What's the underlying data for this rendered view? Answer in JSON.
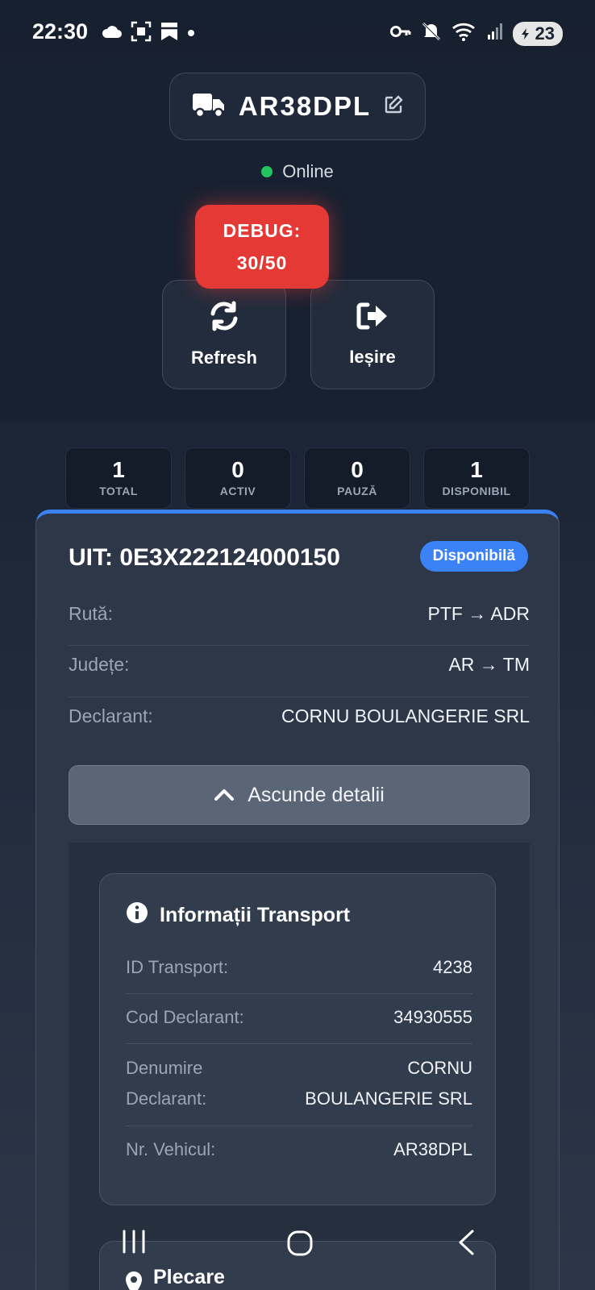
{
  "status_bar": {
    "time": "22:30",
    "battery": "23",
    "icons_left": [
      "cloud-icon",
      "screenshot-icon",
      "bookmark-icon",
      "dot-icon"
    ],
    "icons_right": [
      "key-icon",
      "mute-icon",
      "wifi-icon",
      "signal-icon"
    ]
  },
  "header": {
    "vehicle_plate": "AR38DPL",
    "connection_status": "Online",
    "debug_label": "DEBUG:",
    "debug_value": "30/50",
    "refresh_label": "Refresh",
    "exit_label": "Ieșire"
  },
  "stats": [
    {
      "value": "1",
      "label": "TOTAL"
    },
    {
      "value": "0",
      "label": "ACTIV"
    },
    {
      "value": "0",
      "label": "PAUZĂ"
    },
    {
      "value": "1",
      "label": "DISPONIBIL"
    }
  ],
  "transport": {
    "uit": "UIT: 0E3X222124000150",
    "status_badge": "Disponibilă",
    "rows": [
      {
        "label": "Rută:",
        "value": "PTF → ADR"
      },
      {
        "label": "Județe:",
        "value": "AR → TM"
      },
      {
        "label": "Declarant:",
        "value": "CORNU BOULANGERIE SRL"
      }
    ],
    "toggle_label": "Ascunde detalii"
  },
  "info": {
    "title": "Informații Transport",
    "rows": [
      {
        "label": "ID Transport:",
        "value": "4238"
      },
      {
        "label": "Cod Declarant:",
        "value": "34930555"
      },
      {
        "label_line1": "Denumire",
        "label_line2": "Declarant:",
        "value_line1": "CORNU",
        "value_line2": "BOULANGERIE SRL"
      },
      {
        "label": "Nr. Vehicul:",
        "value": "AR38DPL"
      }
    ]
  },
  "departure": {
    "title": "Plecare"
  },
  "colors": {
    "accent": "#3b82f6",
    "debug": "#e53935",
    "online": "#22c55e"
  }
}
